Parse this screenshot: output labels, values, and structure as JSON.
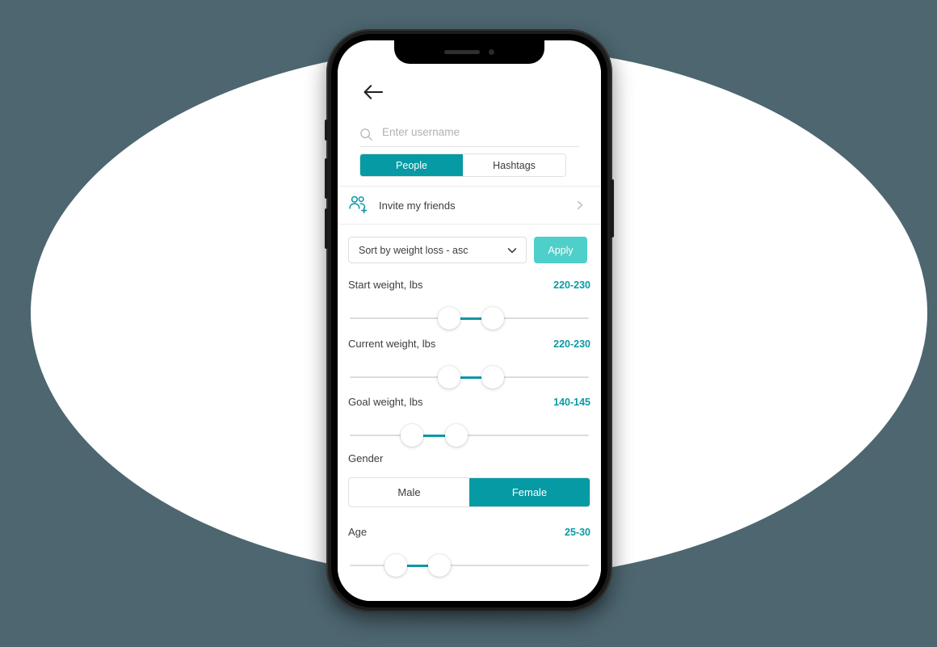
{
  "theme": {
    "background": "#4d6670",
    "ellipse": "#ffffff",
    "accent_teal": "#069aa4",
    "accent_turquoise": "#4fcfc9",
    "value_text": "#0a9aa4"
  },
  "device": {
    "speaker": "speaker-grille",
    "camera": "front-camera"
  },
  "app": {
    "back_label": "back-arrow-icon",
    "search": {
      "icon": "search-icon",
      "placeholder": "Enter username",
      "value": ""
    },
    "tabs": [
      {
        "label": "People",
        "active": true
      },
      {
        "label": "Hashtags",
        "active": false
      }
    ],
    "invite": {
      "icon": "people-add-icon",
      "label": "Invite my friends",
      "chevron": "chevron-right-icon"
    },
    "sort": {
      "selected": "Sort by weight loss - asc",
      "chevron": "chevron-down-icon",
      "apply_label": "Apply"
    },
    "filters": [
      {
        "title": "Start weight, lbs",
        "value": "220-230",
        "low_pct": 41.5,
        "high_pct": 59.8
      },
      {
        "title": "Current weight, lbs",
        "value": "220-230",
        "low_pct": 41.5,
        "high_pct": 59.8
      },
      {
        "title": "Goal weight, lbs",
        "value": "140-145",
        "low_pct": 26.4,
        "high_pct": 44.6
      }
    ],
    "gender": {
      "title": "Gender",
      "options": [
        {
          "label": "Male",
          "active": false
        },
        {
          "label": "Female",
          "active": true
        }
      ]
    },
    "age": {
      "title": "Age",
      "value": "25-30",
      "low_pct": 19.6,
      "high_pct": 37.8
    }
  }
}
